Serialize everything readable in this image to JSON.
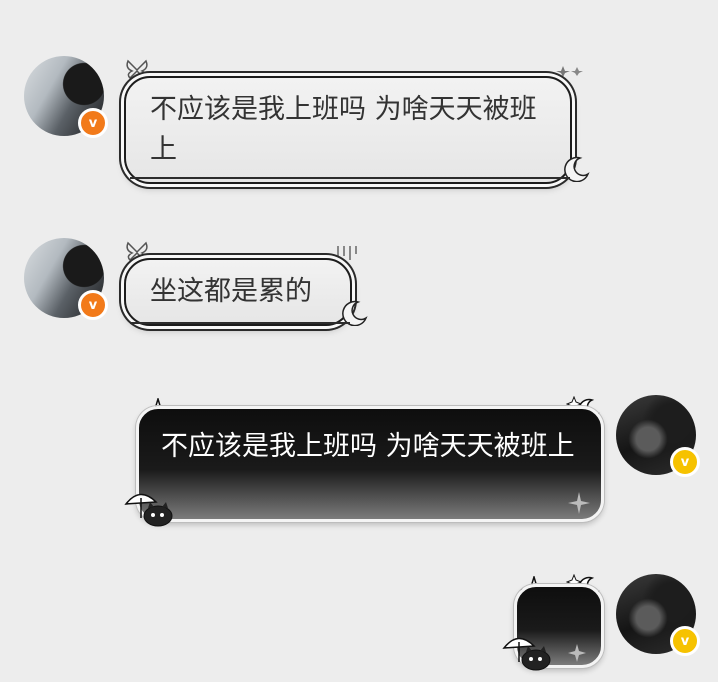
{
  "colors": {
    "background": "#ededed",
    "badge_orange": "#f27a1a",
    "badge_yellow": "#f6c200",
    "light_bubble_text": "#333333",
    "dark_bubble_text": "#ffffff"
  },
  "badge_letter": "v",
  "messages": [
    {
      "side": "left",
      "text": "不应该是我上班吗 为啥天天被班上"
    },
    {
      "side": "left",
      "text": "坐这都是累的"
    },
    {
      "side": "right",
      "text": "不应该是我上班吗 为啥天天被班上"
    },
    {
      "side": "right",
      "text": ""
    }
  ]
}
